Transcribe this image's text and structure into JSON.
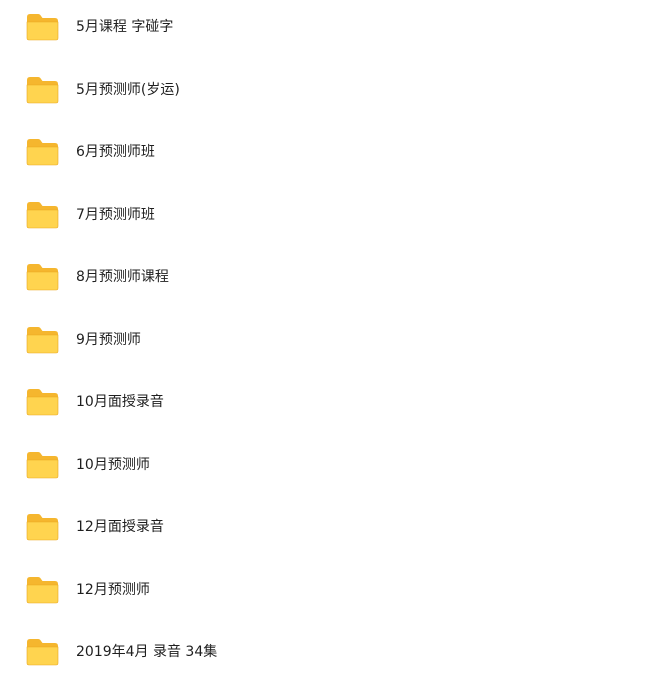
{
  "colors": {
    "folder_tab": "#f5b62e",
    "folder_body": "#ffd44f",
    "folder_edge": "#e9a821"
  },
  "folders": [
    {
      "name": "5月课程 字碰字",
      "icon": "folder-icon"
    },
    {
      "name": "5月预测师(岁运)",
      "icon": "folder-icon"
    },
    {
      "name": "6月预测师班",
      "icon": "folder-icon"
    },
    {
      "name": "7月预测师班",
      "icon": "folder-icon"
    },
    {
      "name": "8月预测师课程",
      "icon": "folder-icon"
    },
    {
      "name": "9月预测师",
      "icon": "folder-icon"
    },
    {
      "name": "10月面授录音",
      "icon": "folder-icon"
    },
    {
      "name": "10月预测师",
      "icon": "folder-icon"
    },
    {
      "name": "12月面授录音",
      "icon": "folder-icon"
    },
    {
      "name": "12月预测师",
      "icon": "folder-icon"
    },
    {
      "name": "2019年4月 录音 34集",
      "icon": "folder-icon"
    }
  ]
}
